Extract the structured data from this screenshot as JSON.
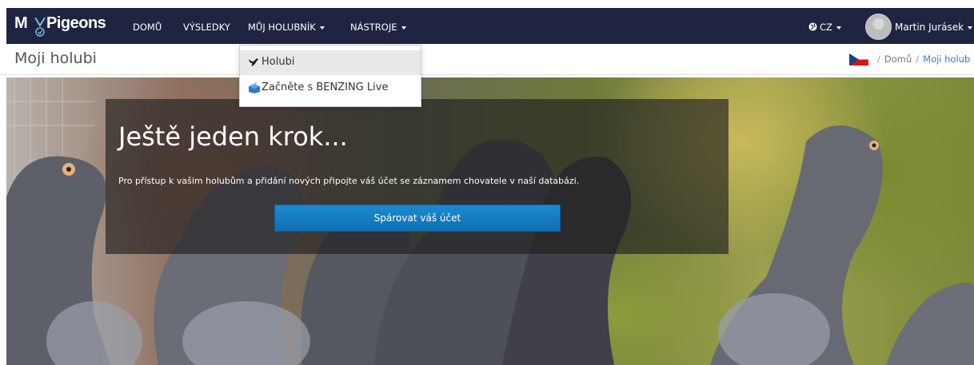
{
  "navbar": {
    "logo_left": "M",
    "logo_right": "Pigeons",
    "items": [
      {
        "label": "DOMŮ"
      },
      {
        "label": "VÝSLEDKY"
      },
      {
        "label": "MŮJ HOLUBNÍK"
      },
      {
        "label": "NÁSTROJE"
      }
    ],
    "language": "CZ",
    "user_name": "Martin Jurásek"
  },
  "page": {
    "title": "Moji holubi"
  },
  "breadcrumb": {
    "home": "Domů",
    "current": "Moji holub"
  },
  "dropdown": {
    "items": [
      {
        "label": "Holubi",
        "icon": "dove-icon"
      },
      {
        "label": "Začněte s BENZING Live",
        "icon": "box-icon"
      }
    ]
  },
  "hero": {
    "heading": "Ještě jeden krok...",
    "text": "Pro přístup k vašim holubům a přidání nových připojte váš účet se záznamem chovatele v naší databázi.",
    "button": "Spárovat váš účet"
  },
  "colors": {
    "navbar_bg": "#1f2540",
    "button_blue": "#1b8ad0",
    "link_blue": "#2f7cc4"
  }
}
